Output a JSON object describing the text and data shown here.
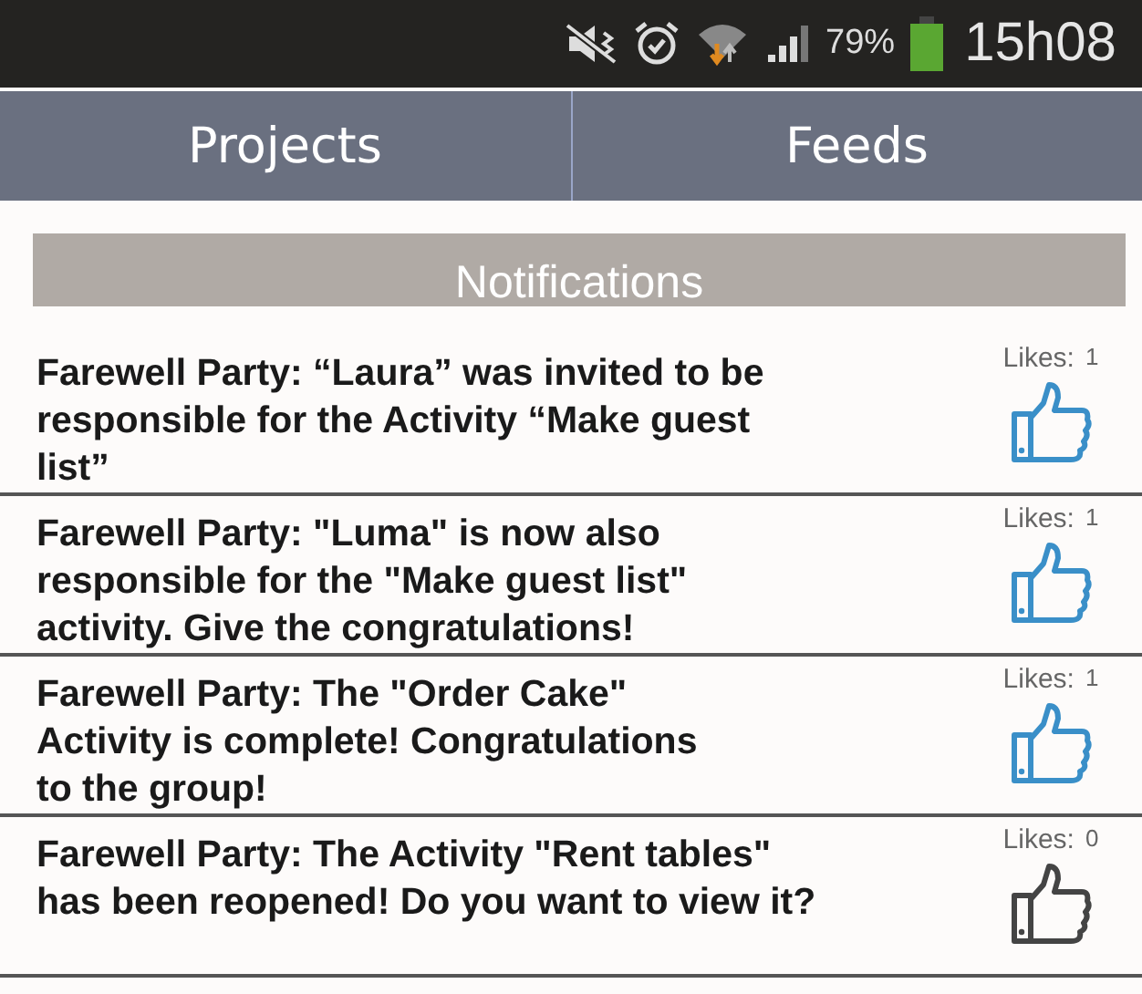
{
  "status_bar": {
    "battery_percent": "79%",
    "time": "15h08"
  },
  "tabs": [
    {
      "label": "Projects"
    },
    {
      "label": "Feeds"
    }
  ],
  "section_title": "Notifications",
  "notifications": [
    {
      "text": "Farewell Party: “Laura” was invited to be\nresponsible for the Activity “Make guest\nlist”",
      "likes_label": "Likes:",
      "likes_count": "1",
      "liked": true
    },
    {
      "text": "Farewell Party: \"Luma\" is now also\nresponsible for the \"Make guest list\"\nactivity. Give the congratulations!",
      "likes_label": "Likes:",
      "likes_count": "1",
      "liked": true
    },
    {
      "text": "Farewell Party: The \"Order Cake\"\nActivity is complete! Congratulations\nto the group!",
      "likes_label": "Likes:",
      "likes_count": "1",
      "liked": true
    },
    {
      "text": "Farewell Party: The Activity \"Rent tables\"\nhas been reopened! Do you want to view it?",
      "likes_label": "Likes:",
      "likes_count": "0",
      "liked": false
    }
  ]
}
